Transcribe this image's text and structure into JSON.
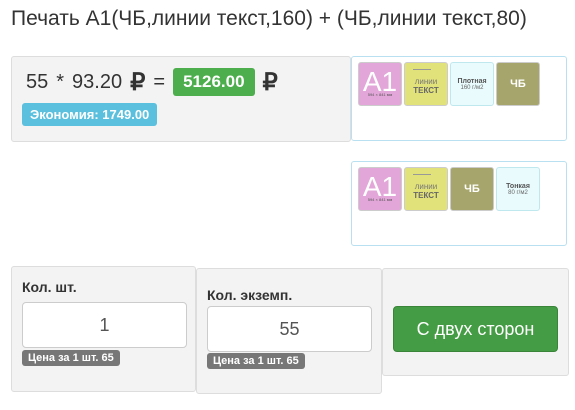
{
  "page": {
    "title": "Печать А1(ЧБ,линии текст,160) + (ЧБ,линии текст,80)"
  },
  "price": {
    "quantity": "55",
    "multiply": "*",
    "unit_price": "93.20",
    "currency": "₽",
    "equals": "=",
    "total": "5126.00",
    "savings": "Экономия: 1749.00"
  },
  "thumbnails_1": [
    {
      "kind": "format",
      "big": "A1",
      "small": "594 × 841 мм",
      "color": "#e3a6d9"
    },
    {
      "kind": "lines",
      "line1": "линии",
      "line2": "ТЕКСТ",
      "color": "#e2e27a"
    },
    {
      "kind": "paper",
      "title": "Плотная",
      "sub": "160 г/м2",
      "color": "#e9fbfd"
    },
    {
      "kind": "bw",
      "label": "ЧБ",
      "color": "#a6a66c"
    }
  ],
  "thumbnails_2": [
    {
      "kind": "format",
      "big": "A1",
      "small": "594 × 841 мм",
      "color": "#e3a6d9"
    },
    {
      "kind": "lines",
      "line1": "линии",
      "line2": "ТЕКСТ",
      "color": "#e2e27a"
    },
    {
      "kind": "bw",
      "label": "ЧБ",
      "color": "#a6a66c"
    },
    {
      "kind": "paper",
      "title": "Тонкая",
      "sub": "80 г/м2",
      "color": "#e9fbfd"
    }
  ],
  "fields": {
    "pieces": {
      "label": "Кол. шт.",
      "value": "1",
      "price_note": "Цена за 1 шт. 65"
    },
    "copies": {
      "label": "Кол. экземп.",
      "value": "55",
      "price_note": "Цена за 1 шт. 65"
    },
    "duplex_button": "С двух сторон"
  },
  "colors": {
    "total_badge": "#4cae4c",
    "savings_badge": "#5bc0de",
    "duplex_button": "#449d44",
    "price_tag": "#777777"
  }
}
